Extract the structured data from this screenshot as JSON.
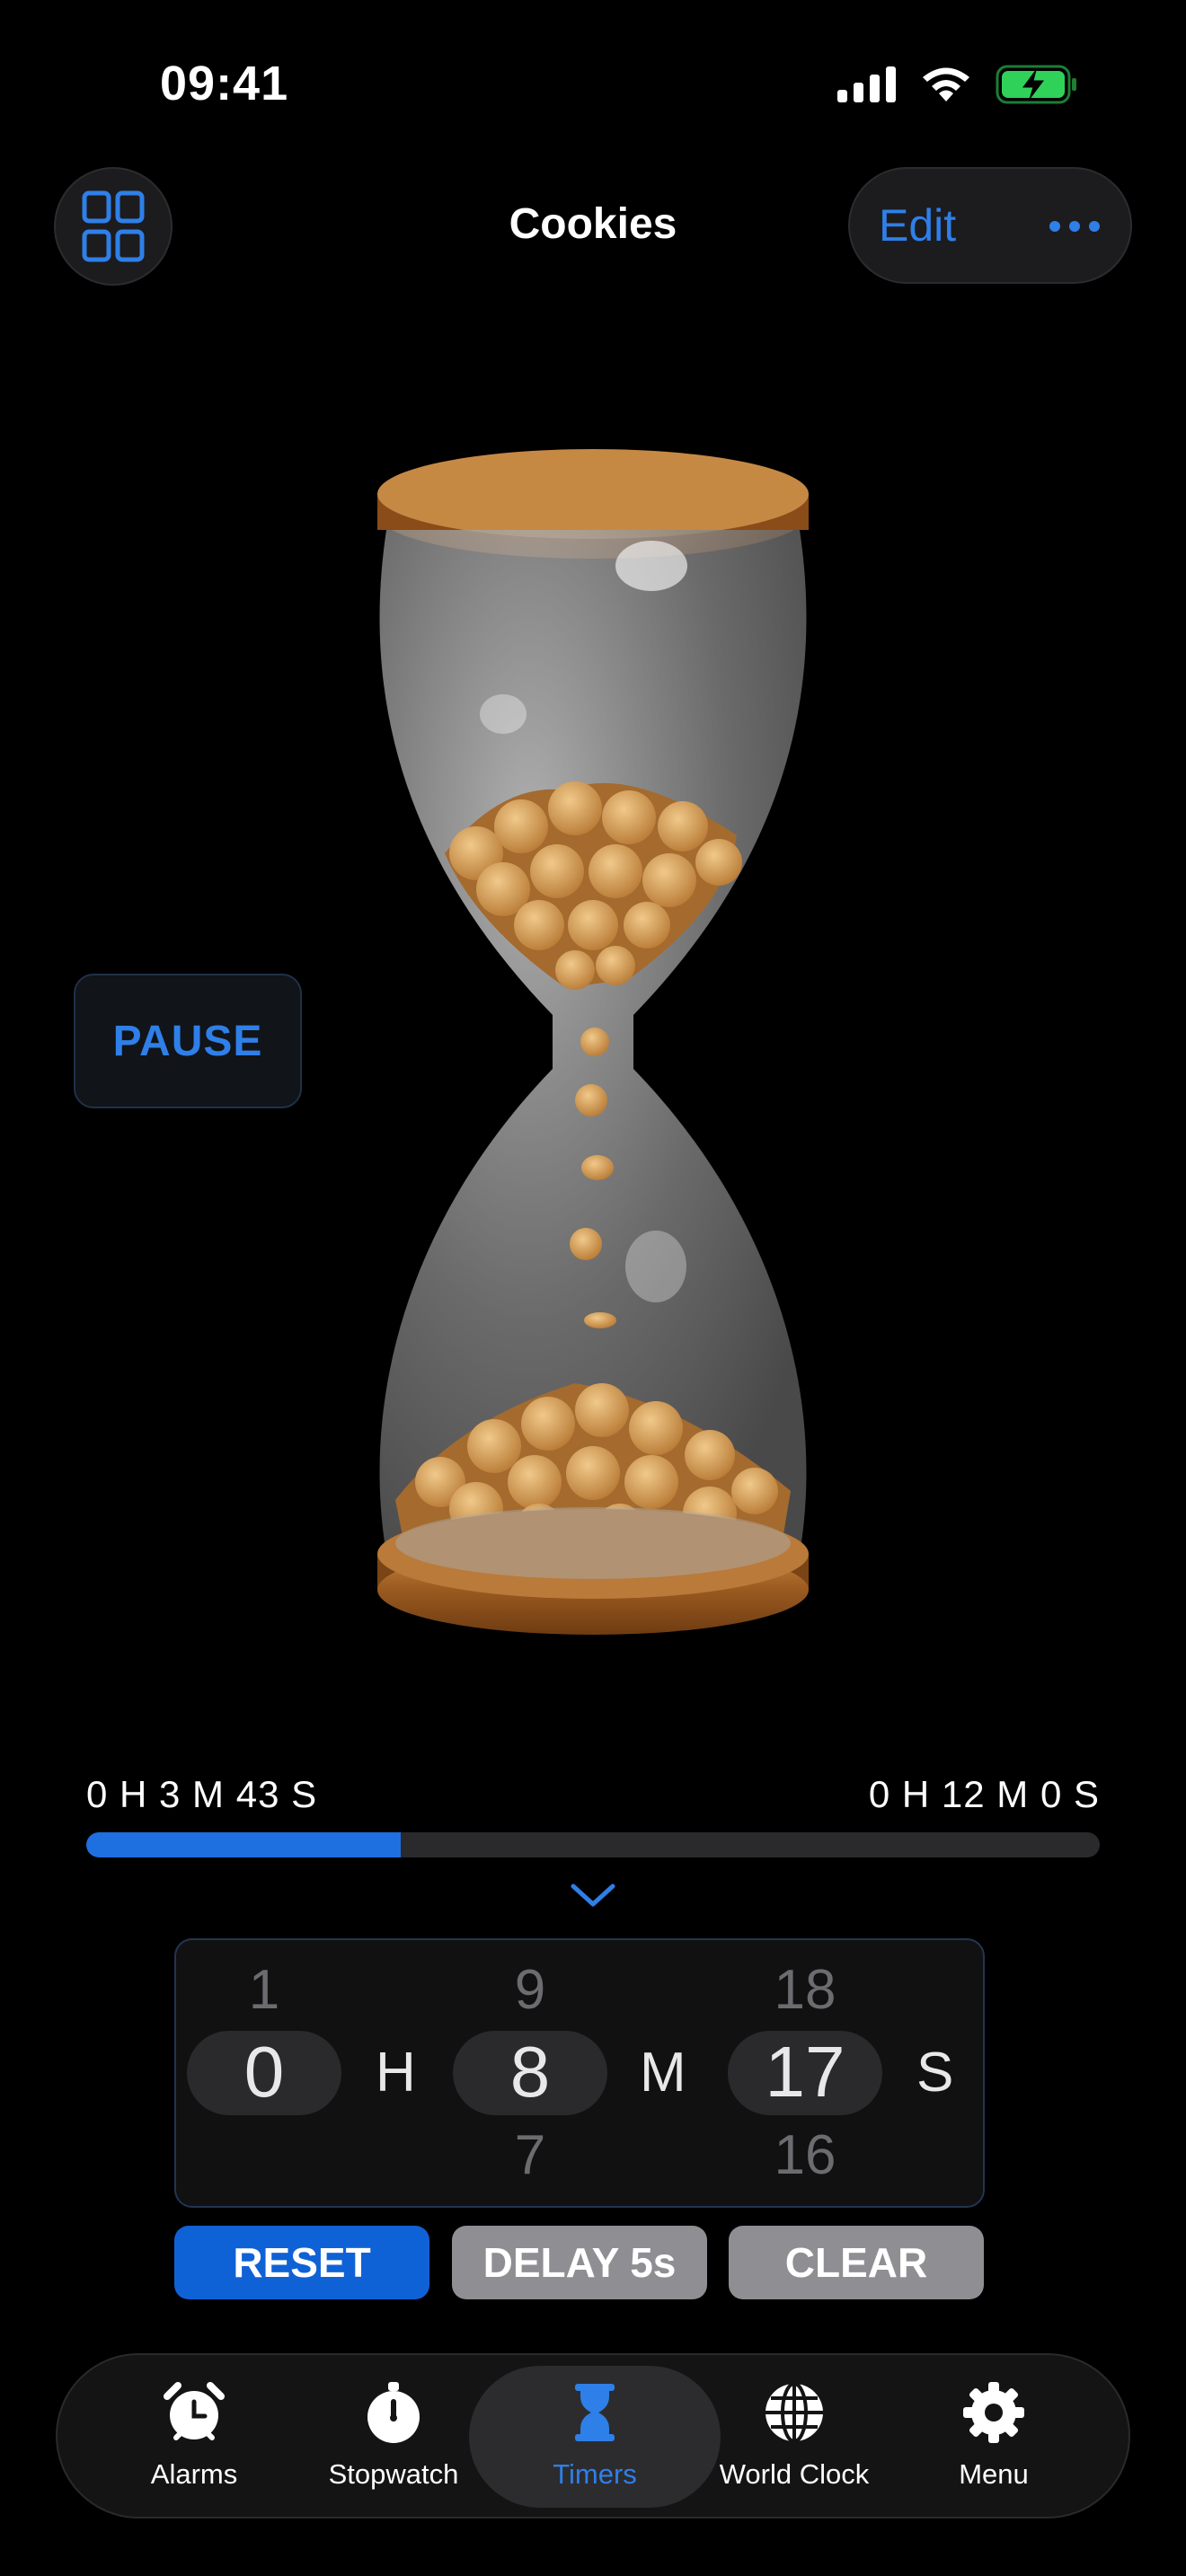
{
  "status_bar": {
    "time": "09:41"
  },
  "header": {
    "title": "Cookies",
    "edit_label": "Edit"
  },
  "pause_label": "PAUSE",
  "progress": {
    "elapsed": "0 H 3 M 43 S",
    "total": "0 H 12 M 0 S",
    "fraction": 0.31
  },
  "picker": {
    "hours": {
      "above": "1",
      "current": "0",
      "below": "",
      "unit": "H"
    },
    "minutes": {
      "above": "9",
      "current": "8",
      "below": "7",
      "unit": "M"
    },
    "seconds": {
      "above": "18",
      "current": "17",
      "below": "16",
      "unit": "S"
    }
  },
  "actions": {
    "reset": "RESET",
    "delay": "DELAY 5s",
    "clear": "CLEAR"
  },
  "tabs": [
    {
      "label": "Alarms",
      "icon": "alarm-clock-icon"
    },
    {
      "label": "Stopwatch",
      "icon": "stopwatch-icon"
    },
    {
      "label": "Timers",
      "icon": "hourglass-icon",
      "active": true
    },
    {
      "label": "World Clock",
      "icon": "globe-icon"
    },
    {
      "label": "Menu",
      "icon": "gear-icon"
    }
  ],
  "colors": {
    "accent": "#2f7fe8",
    "progress": "#1e6fe0",
    "reset": "#0f62d6",
    "battery": "#30d158"
  }
}
